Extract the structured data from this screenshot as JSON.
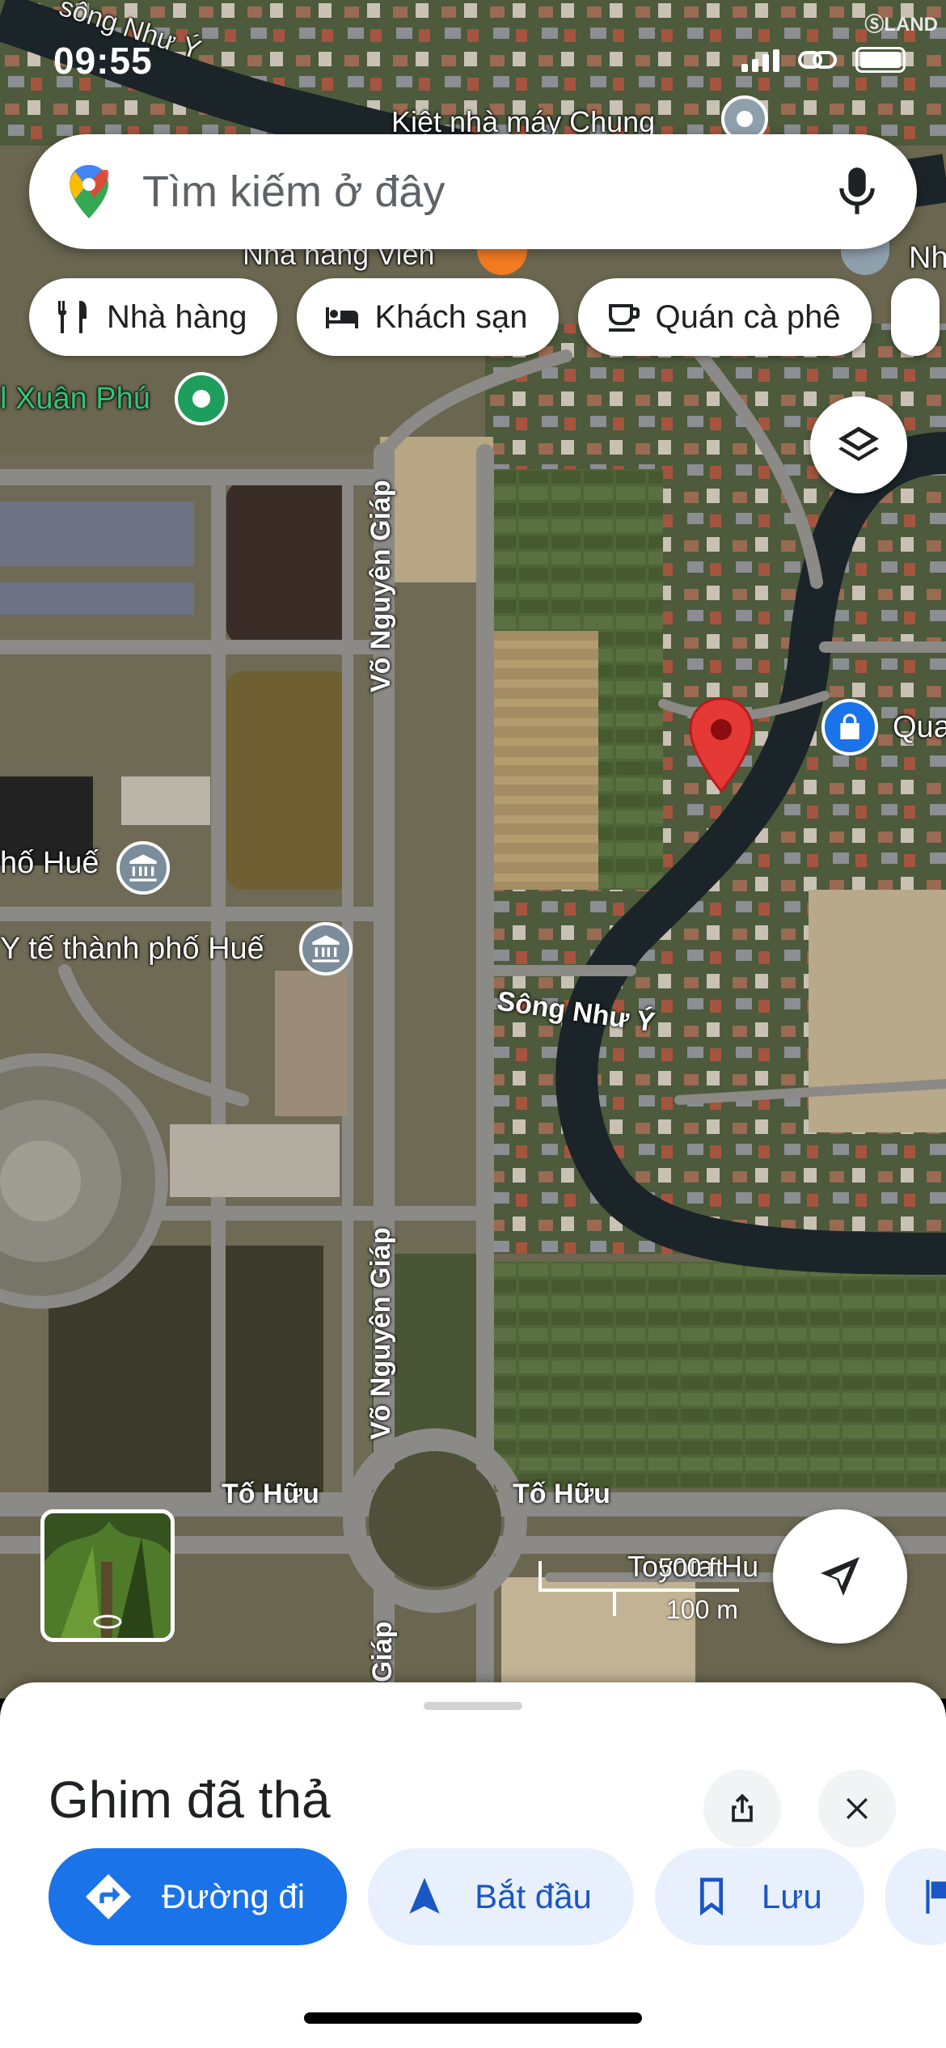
{
  "status_bar": {
    "time": "09:55"
  },
  "map": {
    "watermark": "LAND",
    "labels": {
      "river_top": "sông Như Ý",
      "kiet": "Kiệt nhà máy Chung",
      "nha_hang_vien": "Nhà hàng Viên",
      "nh_right": "Nh",
      "xuan_phu": "l Xuân Phú",
      "quan_right": "Qua",
      "pho_hue": "hố Huế",
      "y_te": "Y tế thành phố Huế",
      "song_nhu_y": "Sông Như Ý",
      "vo_nguyen_giap_1": "Võ Nguyên Giáp",
      "vo_nguyen_giap_2": "Võ Nguyên Giáp",
      "vo_nguyen_giap_3": "Giáp",
      "to_huu_left": "Tố Hữu",
      "to_huu_right": "Tố Hữu",
      "toyota": "Toyota Hu",
      "scale_top": "500 ft",
      "scale_bottom": "100 m"
    }
  },
  "search": {
    "placeholder": "Tìm kiếm ở đây"
  },
  "chips": [
    {
      "label": "Nhà hàng",
      "icon": "restaurant-icon"
    },
    {
      "label": "Khách sạn",
      "icon": "hotel-icon"
    },
    {
      "label": "Quán cà phê",
      "icon": "coffee-icon"
    }
  ],
  "sheet": {
    "title": "Ghim đã thả",
    "actions": [
      {
        "label": "Đường đi",
        "icon": "directions-icon"
      },
      {
        "label": "Bắt đầu",
        "icon": "navigation-icon"
      },
      {
        "label": "Lưu",
        "icon": "bookmark-icon"
      }
    ]
  },
  "colors": {
    "accent": "#1a73e8",
    "pin": "#e53935",
    "sheet_bg": "#ffffff"
  }
}
